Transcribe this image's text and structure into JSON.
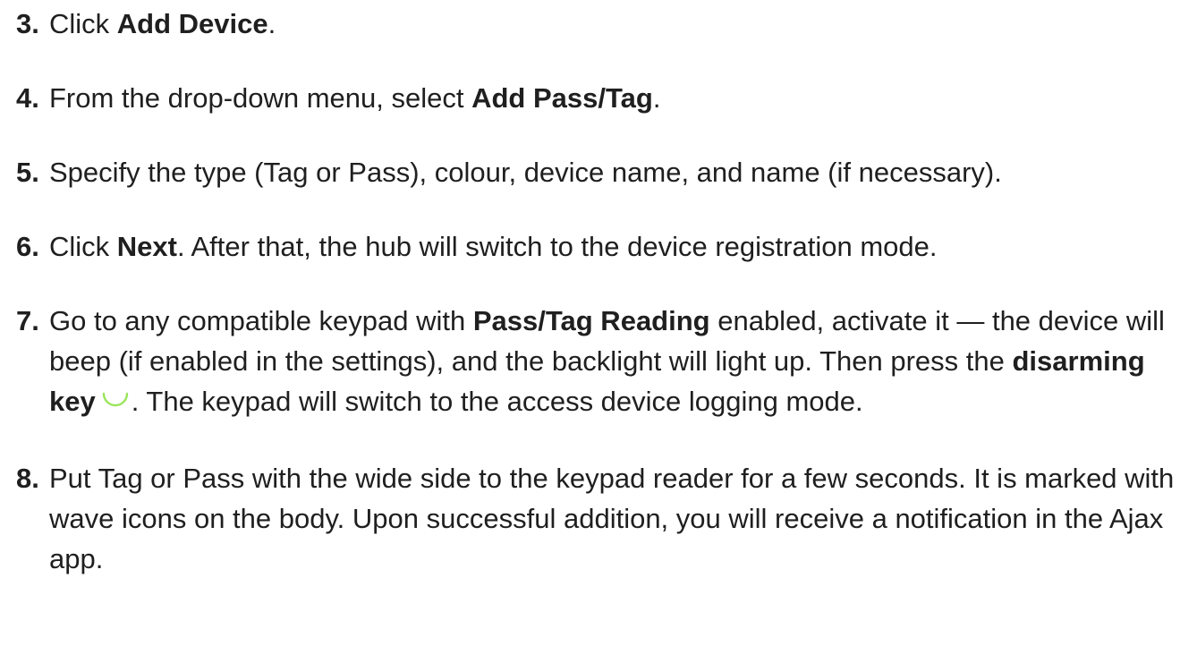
{
  "steps": [
    {
      "num": "3.",
      "parts": [
        {
          "t": "Click "
        },
        {
          "b": "Add Device"
        },
        {
          "t": "."
        }
      ]
    },
    {
      "num": "4.",
      "parts": [
        {
          "t": "From the drop-down menu, select "
        },
        {
          "b": "Add Pass/Tag"
        },
        {
          "t": "."
        }
      ]
    },
    {
      "num": "5.",
      "parts": [
        {
          "t": "Specify the type (Tag or Pass), colour, device name, and name (if necessary)."
        }
      ]
    },
    {
      "num": "6.",
      "parts": [
        {
          "t": "Click "
        },
        {
          "b": "Next"
        },
        {
          "t": ". After that, the hub will switch to the device registration mode."
        }
      ]
    },
    {
      "num": "7.",
      "parts": [
        {
          "t": "Go to any compatible keypad with "
        },
        {
          "b": "Pass/Tag Reading"
        },
        {
          "t": " enabled, activate it — the device will beep (if enabled in the settings), and the backlight will light up. Then press the "
        },
        {
          "b": "disarming key"
        },
        {
          "icon": "disarming-key-icon"
        },
        {
          "t": ". The keypad will switch to the access device logging mode."
        }
      ]
    },
    {
      "num": "8.",
      "parts": [
        {
          "t": "Put Tag or Pass with the wide side to the keypad reader for a few seconds. It is marked with wave icons on the body. Upon successful addition, you will receive a notification in the Ajax app."
        }
      ]
    }
  ],
  "colors": {
    "text": "#1f1f1f",
    "disarm_icon": "#9be55c"
  }
}
